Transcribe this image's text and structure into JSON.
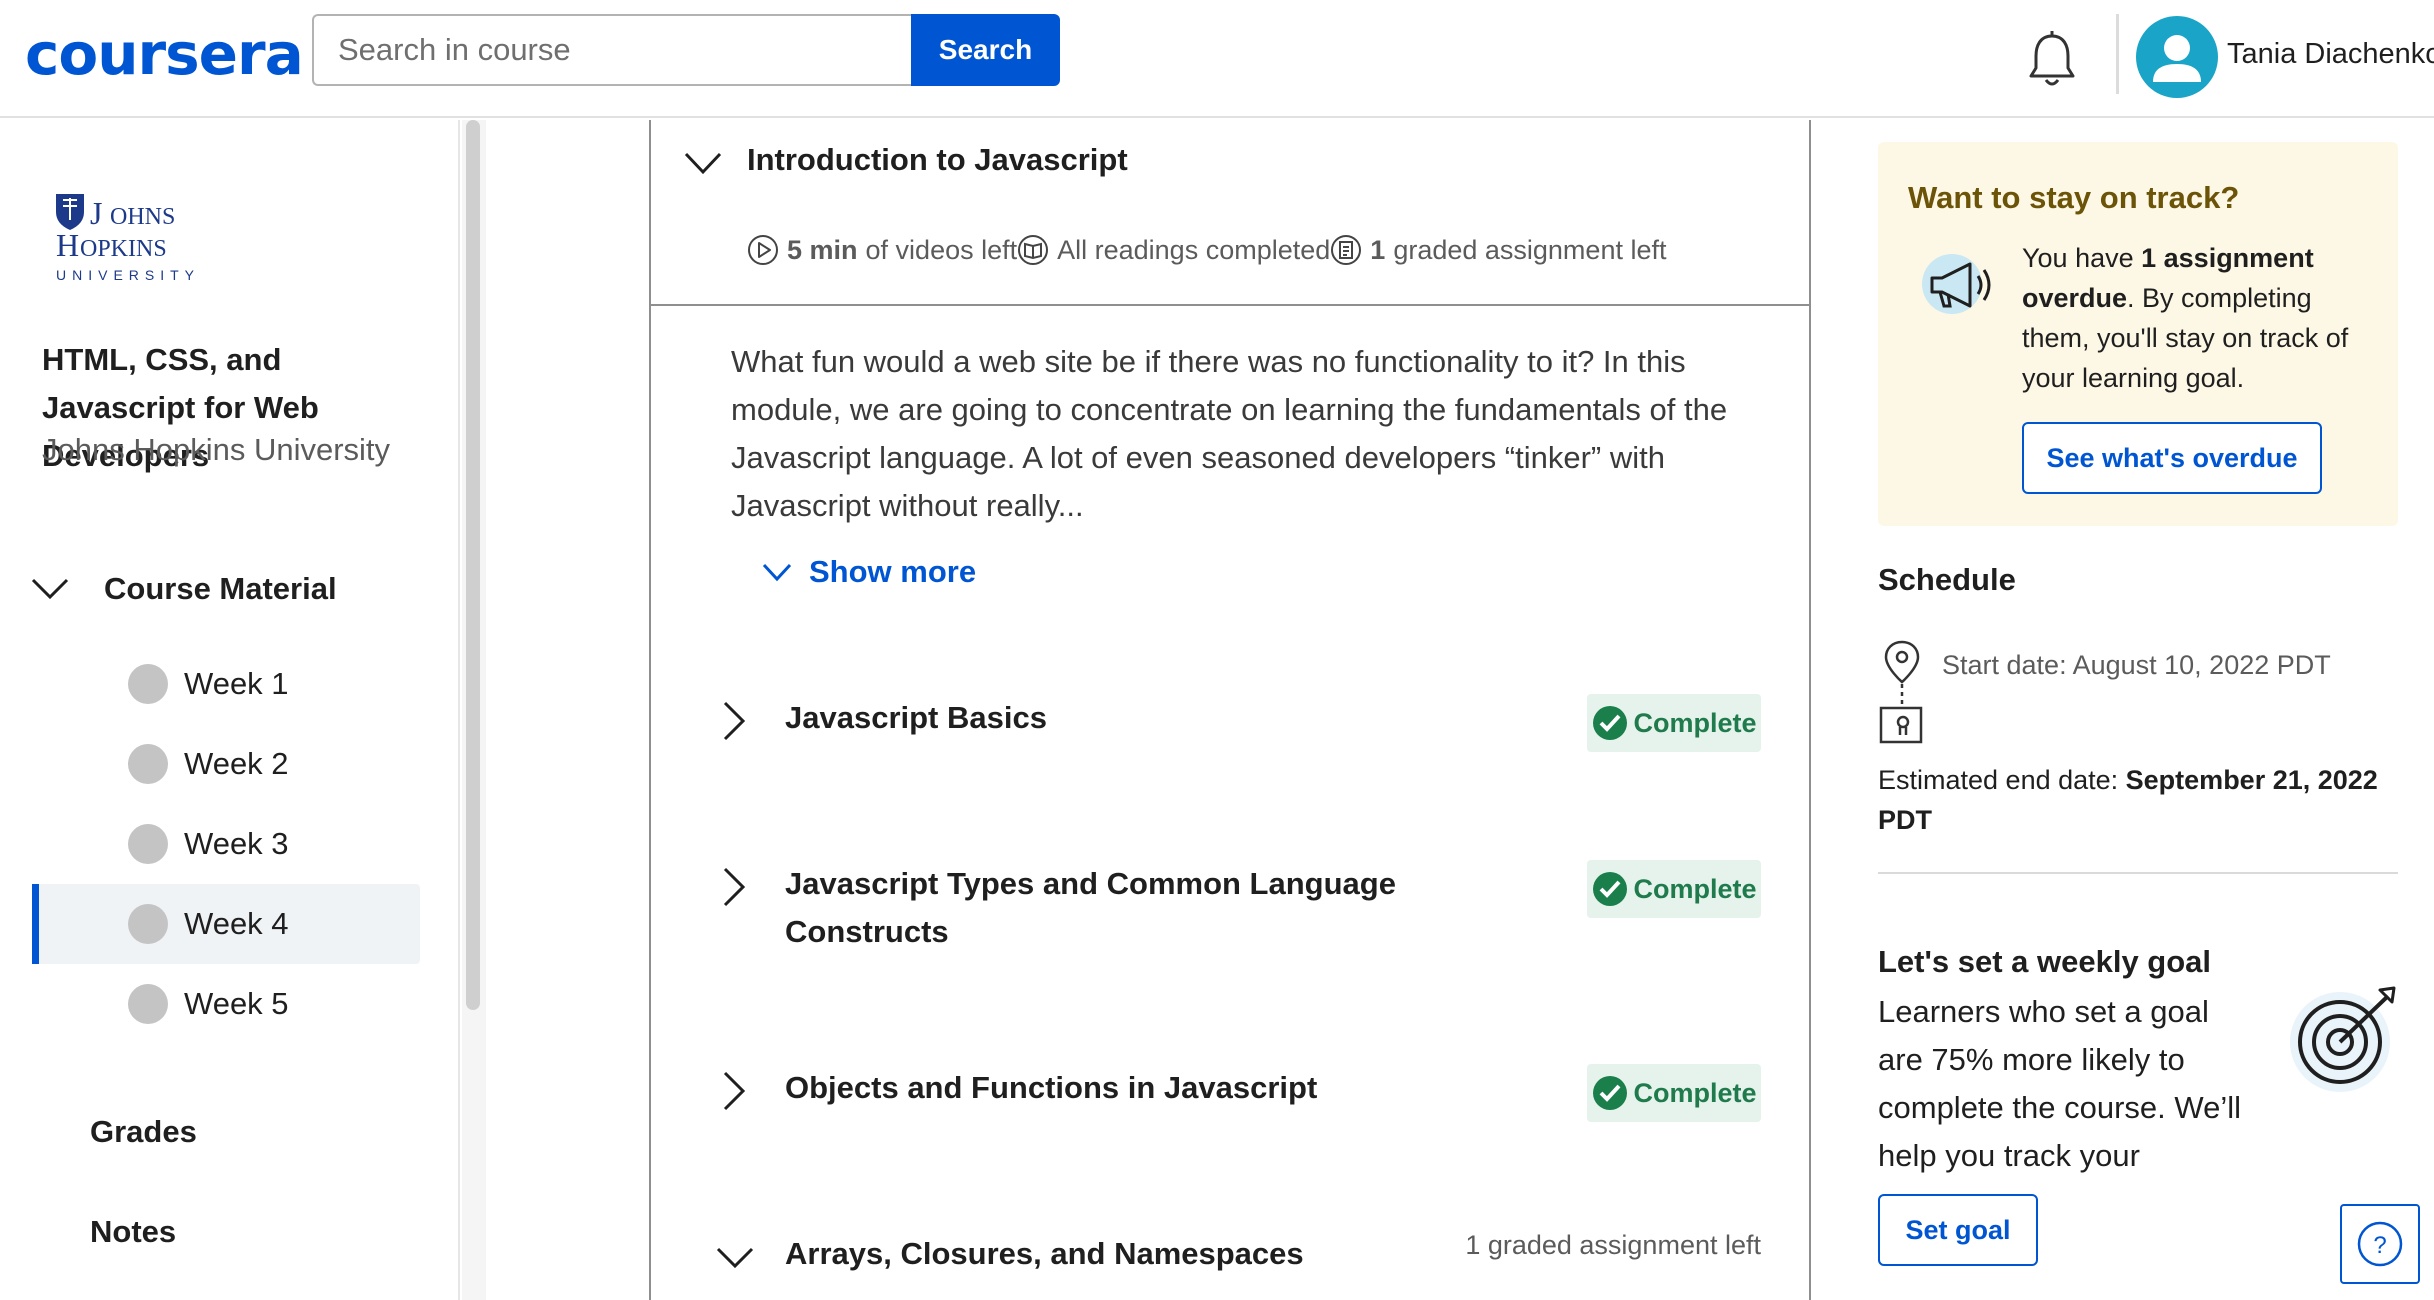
{
  "header": {
    "logo": "coursera",
    "search_placeholder": "Search in course",
    "search_button": "Search",
    "user_name": "Tania Diachenko"
  },
  "sidebar": {
    "university_logo": "JOHNS HOPKINS UNIVERSITY",
    "course_title": "HTML, CSS, and Javascript for Web Developers",
    "course_org": "Johns Hopkins University",
    "course_material_label": "Course Material",
    "weeks": [
      "Week 1",
      "Week 2",
      "Week 3",
      "Week 4",
      "Week 5"
    ],
    "active_week": "Week 4",
    "grades_label": "Grades",
    "notes_label": "Notes"
  },
  "module": {
    "title": "Introduction to Javascript",
    "videos_value": "5 min",
    "videos_text": "of videos left",
    "readings_text": "All readings completed",
    "graded_value": "1",
    "graded_text": "graded assignment left",
    "description": "What fun would a web site be if there was no functionality to it? In this module, we are going to concentrate on learning the fundamentals of the Javascript language. A lot of even seasoned developers “tinker” with Javascript without really...",
    "show_more": "Show more",
    "lessons": [
      {
        "title": "Javascript Basics",
        "status": "Complete"
      },
      {
        "title": "Javascript Types and Common Language Constructs",
        "status": "Complete"
      },
      {
        "title": "Objects and Functions in Javascript",
        "status": "Complete"
      },
      {
        "title": "Arrays, Closures, and Namespaces",
        "status_text": "1 graded assignment left"
      }
    ]
  },
  "right_panel": {
    "track_title": "Want to stay on track?",
    "track_text_pre": "You have ",
    "track_text_bold": "1 assignment overdue",
    "track_text_post": ". By completing them, you'll stay on track of your learning goal.",
    "overdue_button": "See what's overdue",
    "schedule_title": "Schedule",
    "start_date": "Start date: August 10, 2022 PDT",
    "end_date_label": "Estimated end date: ",
    "end_date_value": "September 21, 2022 PDT",
    "goal_title": "Let's set a weekly goal",
    "goal_text": "Learners who set a goal are 75% more likely to complete the course. We’ll help you track your progress.",
    "goal_button": "Set goal",
    "help_label": "?"
  },
  "colors": {
    "brand": "#0056d2",
    "complete_bg": "#e6f2ec",
    "complete_text": "#1f7a4c",
    "track_bg": "#fdf8e6",
    "track_title": "#6b5307"
  },
  "icons": [
    "bell-icon",
    "avatar-icon",
    "chevron-down-icon",
    "chevron-right-icon",
    "play-icon",
    "book-icon",
    "assignment-icon",
    "check-circle-icon",
    "megaphone-icon",
    "location-pin-icon",
    "certificate-icon",
    "target-icon",
    "help-icon"
  ]
}
